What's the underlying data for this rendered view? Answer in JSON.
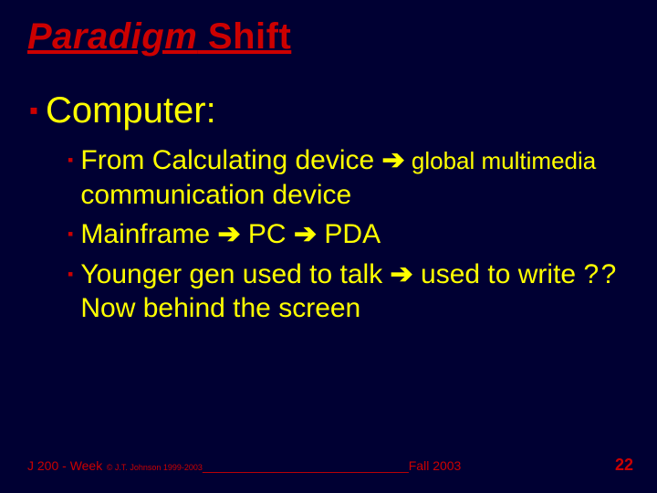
{
  "title": {
    "italic": "Paradigm",
    "rest": " Shift"
  },
  "heading": "Computer:",
  "bullets": [
    {
      "pre": "From Calculating device ",
      "arrow1": "➔",
      "mid_small": " global multimedia ",
      "post": "communication device"
    },
    {
      "text_a": "Mainframe ",
      "arrow1": "➔",
      "text_b": " PC ",
      "arrow2": "➔",
      "text_c": " PDA"
    },
    {
      "text_a": "Younger gen used to talk ",
      "arrow1": "➔",
      "text_b": " used to write ? ? Now behind the screen"
    }
  ],
  "footer": {
    "course": "J 200 - Week",
    "copy": " © J.T. Johnson 1999-2003",
    "line": "_____________________________",
    "term": "Fall 2003"
  },
  "page": "22"
}
